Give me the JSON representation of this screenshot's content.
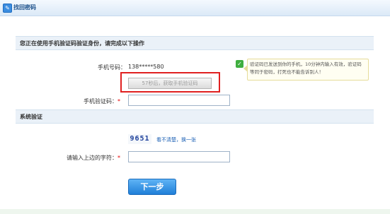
{
  "header": {
    "icon": "key-icon",
    "title": "找回密码"
  },
  "phone_section": {
    "title": "您正在使用手机验证码验证身份，请完成以下操作",
    "phone_label": "手机号码：",
    "phone_value": "138*****580",
    "send_button_label": "57秒后，获取手机验证码",
    "tip_text": "验证码已发送到你的手机，10分钟内输入有效，验证码等同于密码，打死也不能告诉别人！",
    "code_label": "手机验证码：",
    "required_mark": "*"
  },
  "system_section": {
    "title": "系统验证",
    "captcha_text": "9651",
    "refresh_link": "看不清楚，换一张",
    "char_label": "请输入上边的字符：",
    "required_mark": "*"
  },
  "submit": {
    "label": "下一步"
  },
  "colors": {
    "accent": "#1f7fd8",
    "highlight_box": "#e02020",
    "required": "#e60000"
  }
}
